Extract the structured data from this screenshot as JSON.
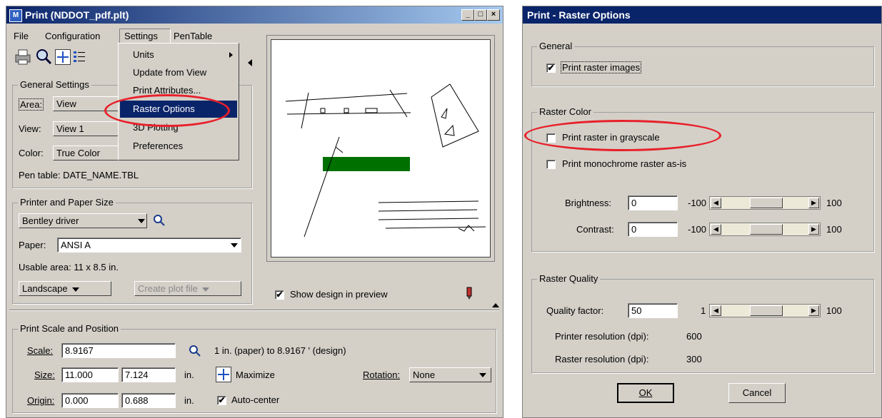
{
  "print": {
    "title": "Print  (NDDOT_pdf.plt)",
    "menubar": [
      "File",
      "Configuration",
      "Settings",
      "PenTable"
    ],
    "settings_menu": [
      "Units",
      "Update from View",
      "Print Attributes...",
      "Raster Options",
      "3D Plotting",
      "Preferences"
    ],
    "general": {
      "legend": "General Settings",
      "area_label": "Area:",
      "area_value": "View",
      "view_label": "View:",
      "view_value": "View 1",
      "color_label": "Color:",
      "color_value": "True Color",
      "pentable": "Pen table:   DATE_NAME.TBL"
    },
    "printer": {
      "legend": "Printer and Paper Size",
      "driver": "Bentley driver",
      "paper_label": "Paper:",
      "paper_value": "ANSI A",
      "usable": "Usable area:   11 x 8.5 in.",
      "orientation": "Landscape",
      "create_plot": "Create plot file"
    },
    "show_design": "Show design in preview",
    "scale_section": {
      "legend": "Print Scale and Position",
      "scale_label": "Scale:",
      "scale_value": "8.9167",
      "scale_desc": "1 in. (paper) to 8.9167 ' (design)",
      "size_label": "Size:",
      "size_w": "11.000",
      "size_h": "7.124",
      "size_unit": "in.",
      "maximize": "Maximize",
      "rotation_label": "Rotation:",
      "rotation_value": "None",
      "origin_label": "Origin:",
      "origin_x": "0.000",
      "origin_y": "0.688",
      "origin_unit": "in.",
      "autocenter": "Auto-center"
    }
  },
  "raster": {
    "title": "Print - Raster Options",
    "general_legend": "General",
    "print_raster_images": "Print raster images",
    "color_legend": "Raster Color",
    "grayscale": "Print raster in grayscale",
    "monochrome": "Print monochrome raster as-is",
    "brightness_label": "Brightness:",
    "brightness_value": "0",
    "contrast_label": "Contrast:",
    "contrast_value": "0",
    "min": "-100",
    "max": "100",
    "quality_legend": "Raster Quality",
    "quality_label": "Quality factor:",
    "quality_value": "50",
    "q_min": "1",
    "q_max": "100",
    "printer_res_label": "Printer resolution (dpi):",
    "printer_res_value": "600",
    "raster_res_label": "Raster resolution (dpi):",
    "raster_res_value": "300",
    "ok": "OK",
    "cancel": "Cancel"
  },
  "colors": {
    "title_dark": "#0a246a",
    "highlight": "#e8202a",
    "face": "#d4d0c8",
    "green": "#007000"
  }
}
